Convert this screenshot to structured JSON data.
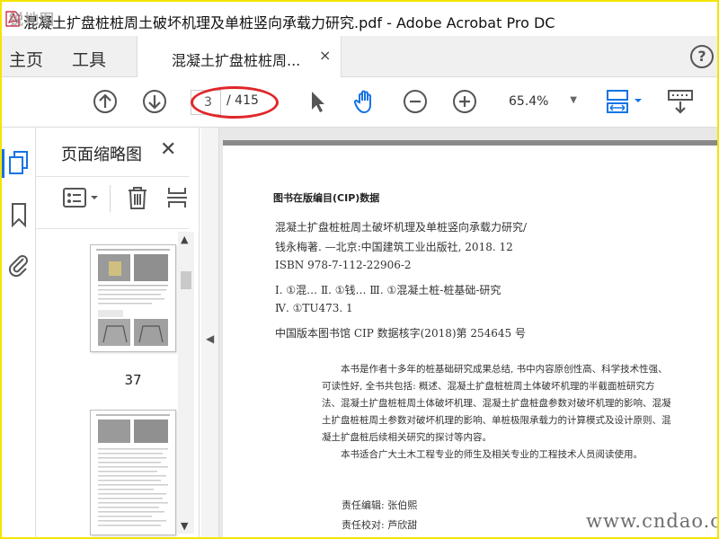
{
  "window": {
    "title": "混凝土扩盘桩桩周土破坏机理及单桩竖向承载力研究.pdf - Adobe Acrobat Pro DC",
    "watermark_top": "锐地图"
  },
  "tabs": {
    "home": "主页",
    "tools": "工具",
    "document": "混凝土扩盘桩桩周...",
    "close": "×",
    "help": "?"
  },
  "toolbar": {
    "page_current": "3",
    "page_total": "/ 415",
    "zoom": "65.4%",
    "zoom_caret": "▼"
  },
  "panel": {
    "title": "页面缩略图",
    "close": "✕",
    "thumb_page_label": "37"
  },
  "document": {
    "cip_title": "图书在版编目(CIP)数据",
    "line1": "混凝土扩盘桩桩周土破坏机理及单桩竖向承载力研究/",
    "line2": "钱永梅著. —北京:中国建筑工业出版社, 2018. 12",
    "line3": "ISBN 978-7-112-22906-2",
    "line4": "Ⅰ. ①混…  Ⅱ. ①钱…  Ⅲ. ①混凝土桩-桩基础-研究",
    "line5": "Ⅳ. ①TU473. 1",
    "line6": "中国版本图书馆 CIP 数据核字(2018)第 254645 号",
    "summary_p1": "本书是作者十多年的桩基础研究成果总结, 书中内容原创性高、科学技术性强、可读性好, 全书共包括: 概述、混凝土扩盘桩桩周土体破坏机理的半截面桩研究方法、混凝土扩盘桩桩周土体破坏机理、混凝土扩盘桩盘参数对破坏机理的影响、混凝土扩盘桩桩周土参数对破坏机理的影响、单桩极限承载力的计算模式及设计原则、混凝土扩盘桩后续相关研究的探讨等内容。",
    "summary_p2": "本书适合广大土木工程专业的师生及相关专业的工程技术人员阅读使用。",
    "editor": "责任编辑: 张伯熙",
    "proofreader": "责任校对: 芦欣甜"
  },
  "watermark": "www.cndao.com",
  "colors": {
    "frame": "#f5e400",
    "accent": "#1473e6",
    "highlight_oval": "#e0262a"
  }
}
